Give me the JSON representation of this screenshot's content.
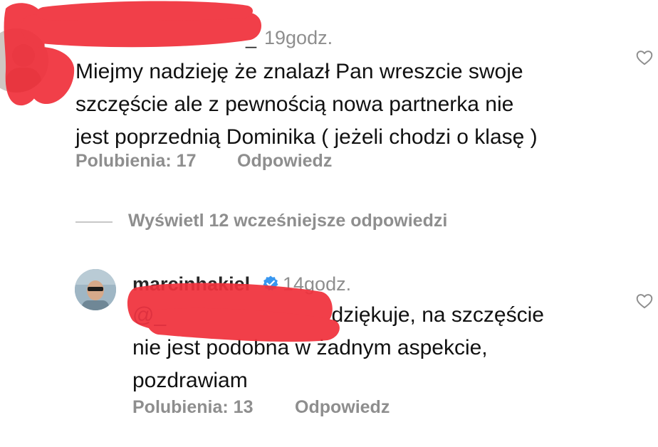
{
  "comments": [
    {
      "username": "_",
      "time": "19godz.",
      "text_lines": [
        "Miejmy nadzieję że znalazł Pan wreszcie swoje",
        "szczęście ale z pewnością nowa partnerka nie",
        "jest poprzednią Dominika ( jeżeli chodzi o klasę )"
      ],
      "likes": "Polubienia: 17",
      "reply_label": "Odpowiedz"
    }
  ],
  "view_replies": "Wyświetl 12 wcześniejsze odpowiedzi",
  "reply": {
    "username": "marcinhakiel",
    "time": "14godz.",
    "mention": "@_",
    "text_line1_rest": " dziękuje, na szczęście",
    "text_line2": "nie jest podobna w żadnym aspekcie,",
    "text_line3": "pozdrawiam",
    "likes": "Polubienia: 13",
    "reply_label": "Odpowiedz"
  },
  "icons": {
    "like": "heart-outline-icon",
    "verified": "verified-badge-icon"
  },
  "colors": {
    "muted": "#8e8e8e",
    "verified_blue": "#3897f0",
    "redaction": "#f0313c"
  }
}
